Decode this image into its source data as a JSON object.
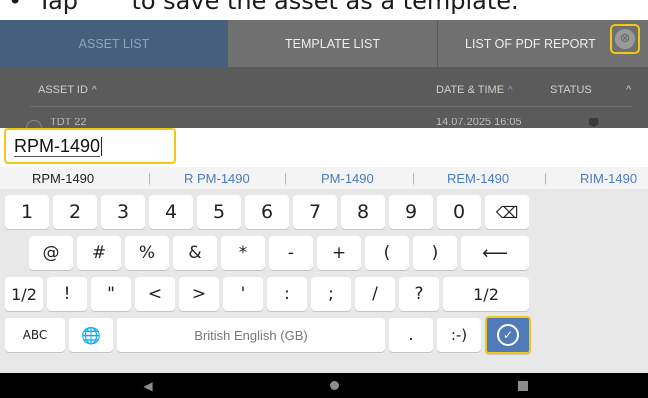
{
  "instruction": "•  Tap       to save the asset as a template.",
  "tabs": {
    "asset_list": "ASSET LIST",
    "template_list": "TEMPLATE LIST",
    "pdf_reports": "LIST OF PDF REPORT"
  },
  "close_icon": "⊗",
  "table": {
    "col_asset_id": "ASSET ID",
    "col_datetime": "DATE & TIME",
    "col_status": "STATUS",
    "sort_icon": "^",
    "row1_id": "TDT 22",
    "row1_datetime": "14.07.2025 16:05"
  },
  "input": {
    "value": "RPM-1490"
  },
  "suggestions": {
    "s1": "RPM-1490",
    "s2": "R PM-1490",
    "s3": "PM-1490",
    "s4": "REM-1490",
    "s5": "RIM-1490",
    "sep": "|"
  },
  "keyboard": {
    "row1": [
      "1",
      "2",
      "3",
      "4",
      "5",
      "6",
      "7",
      "8",
      "9",
      "0",
      "⌫"
    ],
    "row2": [
      "@",
      "#",
      "%",
      "&",
      "*",
      "-",
      "+",
      "(",
      ")",
      "⟵"
    ],
    "row3": [
      "1/2",
      "!",
      "\"",
      "<",
      ">",
      "'",
      ":",
      ";",
      "/",
      "?",
      "1/2"
    ],
    "abc": "ABC",
    "globe": "🌐",
    "space": "British English (GB)",
    "period": ".",
    "smiley": ":-)",
    "enter": "✓"
  },
  "navbar": {
    "back": "◀"
  },
  "colors": {
    "accent": "#f3c614",
    "tab_active": "#455f7d",
    "enter": "#4f7bb8"
  }
}
